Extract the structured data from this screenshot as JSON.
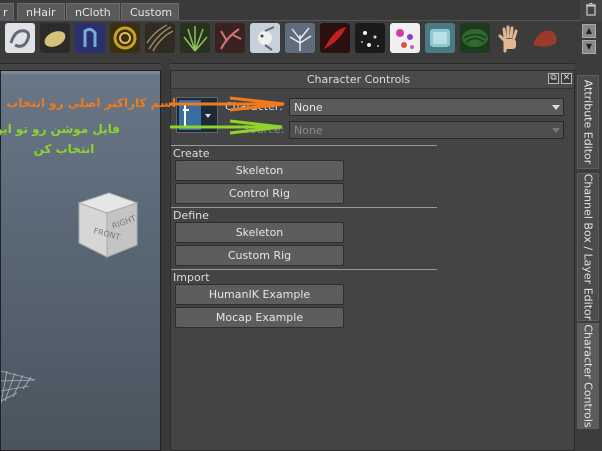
{
  "tabs": [
    "r",
    "nHair",
    "nCloth",
    "Custom"
  ],
  "shelf": {
    "icons": [
      "cloth-swirl-icon",
      "ellipse-icon",
      "hair-curve-icon",
      "spiral-icon",
      "hair-strands-icon",
      "grass-icon",
      "branch-icon",
      "creature-icon",
      "tree-icon",
      "red-feather-icon",
      "sparkle-icon",
      "bubbles-icon",
      "water-icon",
      "scales-icon",
      "hand-icon",
      "muscle-icon"
    ]
  },
  "panel": {
    "title": "Character Controls",
    "character_label": "Character:",
    "character_value": "None",
    "source_label": "Source:",
    "source_value": "None",
    "sections": {
      "create": "Create",
      "define": "Define",
      "import": "Import"
    },
    "buttons": {
      "create_skeleton": "Skeleton",
      "create_control_rig": "Control Rig",
      "define_skeleton": "Skeleton",
      "define_custom_rig": "Custom Rig",
      "import_humanik": "HumanIK Example",
      "import_mocap": "Mocap Example"
    }
  },
  "side_tabs": [
    "Attribute Editor",
    "Channel Box / Layer Editor",
    "Character Controls"
  ],
  "viewcube": {
    "front": "FRONT",
    "right": "RIGHT"
  },
  "annotations": {
    "orange": "اسم کاراکتر اصلی رو انتخاب",
    "green_line1": "فایل موشن رو تو این",
    "green_line2": "انتخاب کن"
  },
  "colors": {
    "orange": "#f07a1c",
    "green": "#8ed42b"
  }
}
